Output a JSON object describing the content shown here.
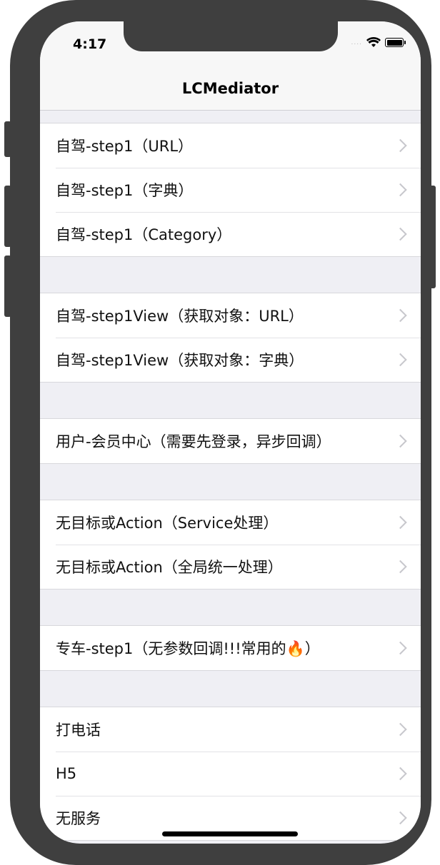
{
  "status_bar": {
    "time": "4:17",
    "signal": "....",
    "wifi_icon": "wifi-icon",
    "battery_icon": "battery-icon"
  },
  "nav": {
    "title": "LCMediator"
  },
  "sections": [
    {
      "rows": [
        {
          "label": "自驾-step1（URL）"
        },
        {
          "label": "自驾-step1（字典）"
        },
        {
          "label": "自驾-step1（Category）"
        }
      ]
    },
    {
      "rows": [
        {
          "label": "自驾-step1View（获取对象：URL）"
        },
        {
          "label": "自驾-step1View（获取对象：字典）"
        }
      ]
    },
    {
      "rows": [
        {
          "label": "用户-会员中心（需要先登录，异步回调）"
        }
      ]
    },
    {
      "rows": [
        {
          "label": "无目标或Action（Service处理）"
        },
        {
          "label": "无目标或Action（全局统一处理）"
        }
      ]
    },
    {
      "rows": [
        {
          "label": "专车-step1（无参数回调!!!常用的🔥）"
        }
      ]
    },
    {
      "rows": [
        {
          "label": "打电话"
        },
        {
          "label": "H5"
        },
        {
          "label": "无服务"
        }
      ]
    }
  ]
}
